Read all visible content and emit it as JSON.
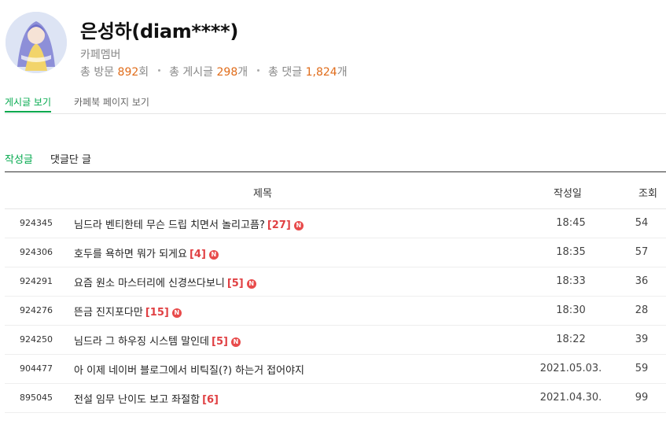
{
  "profile": {
    "name": "은성하(diam****)",
    "role": "카페멤버",
    "visits_label": "총 방문",
    "visits": "892",
    "visits_unit": "회",
    "posts_label": "총 게시글",
    "posts": "298",
    "posts_unit": "개",
    "comments_label": "총 댓글",
    "comments": "1,824",
    "comments_unit": "개"
  },
  "tabs": [
    "게시글 보기",
    "카페북 페이지 보기"
  ],
  "subtabs": [
    "작성글",
    "댓글단 글"
  ],
  "table": {
    "headers": {
      "title": "제목",
      "date": "작성일",
      "views": "조회"
    },
    "rows": [
      {
        "id": "924345",
        "title": "님드라 벤티한테 무슨 드립 치면서 놀리고픔?",
        "comments": "[27]",
        "new": "N",
        "date": "18:45",
        "views": "54"
      },
      {
        "id": "924306",
        "title": "호두를 욕하면 뭐가 되게요",
        "comments": "[4]",
        "new": "N",
        "date": "18:35",
        "views": "57"
      },
      {
        "id": "924291",
        "title": "요즘 원소 마스터리에 신경쓰다보니",
        "comments": "[5]",
        "new": "N",
        "date": "18:33",
        "views": "36"
      },
      {
        "id": "924276",
        "title": "뜬금 진지포다만",
        "comments": "[15]",
        "new": "N",
        "date": "18:30",
        "views": "28"
      },
      {
        "id": "924250",
        "title": "님드라 그 하우징 시스템 말인데",
        "comments": "[5]",
        "new": "N",
        "date": "18:22",
        "views": "39"
      },
      {
        "id": "904477",
        "title": "아 이제 네이버 블로그에서 비틱질(?) 하는거 접어야지",
        "comments": "",
        "new": "",
        "date": "2021.05.03.",
        "views": "59"
      },
      {
        "id": "895045",
        "title": "전설 임무 난이도 보고 좌절함",
        "comments": "[6]",
        "new": "",
        "date": "2021.04.30.",
        "views": "99"
      }
    ]
  },
  "colors": {
    "accent": "#03a94d",
    "number": "#e06c1a",
    "comment": "#e04043",
    "new_badge": "#e84b4b"
  }
}
